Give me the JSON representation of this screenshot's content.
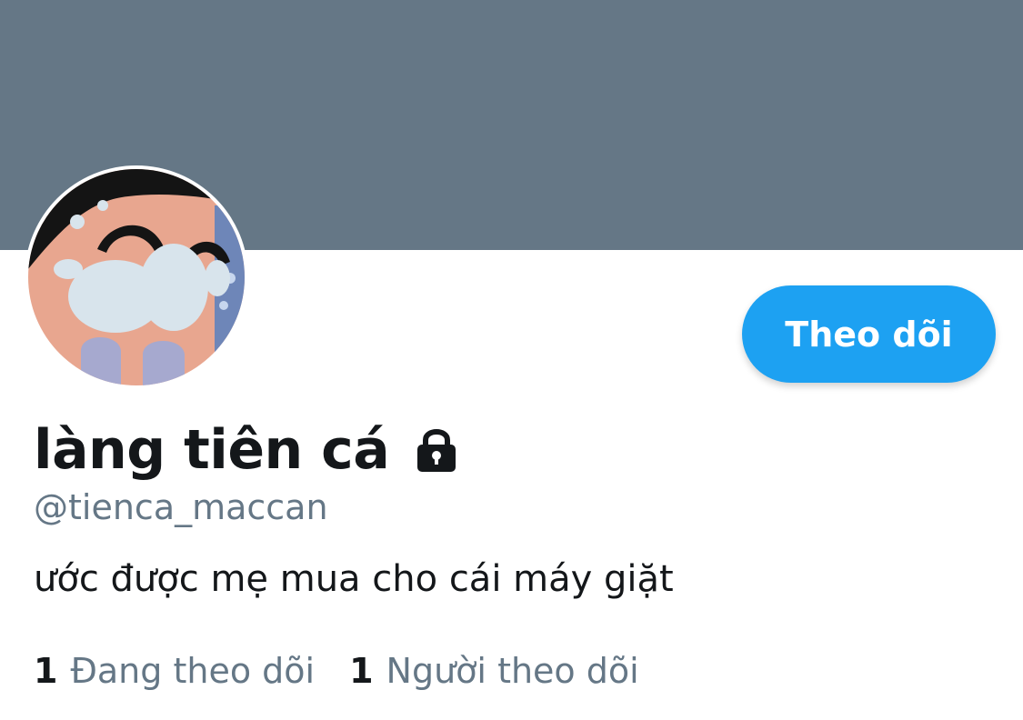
{
  "profile": {
    "display_name": "làng tiên cá",
    "handle": "@tienca_maccan",
    "bio": "ước được mẹ mua cho cái máy giặt",
    "protected_icon": "lock-icon",
    "avatar_icon": "cartoon-avatar"
  },
  "actions": {
    "follow_label": "Theo dõi"
  },
  "stats": {
    "following_count": "1",
    "following_label": "Đang theo dõi",
    "followers_count": "1",
    "followers_label": "Người theo dõi"
  },
  "colors": {
    "banner": "#657786",
    "accent": "#1da1f2",
    "text_primary": "#14171a",
    "text_secondary": "#657786"
  }
}
